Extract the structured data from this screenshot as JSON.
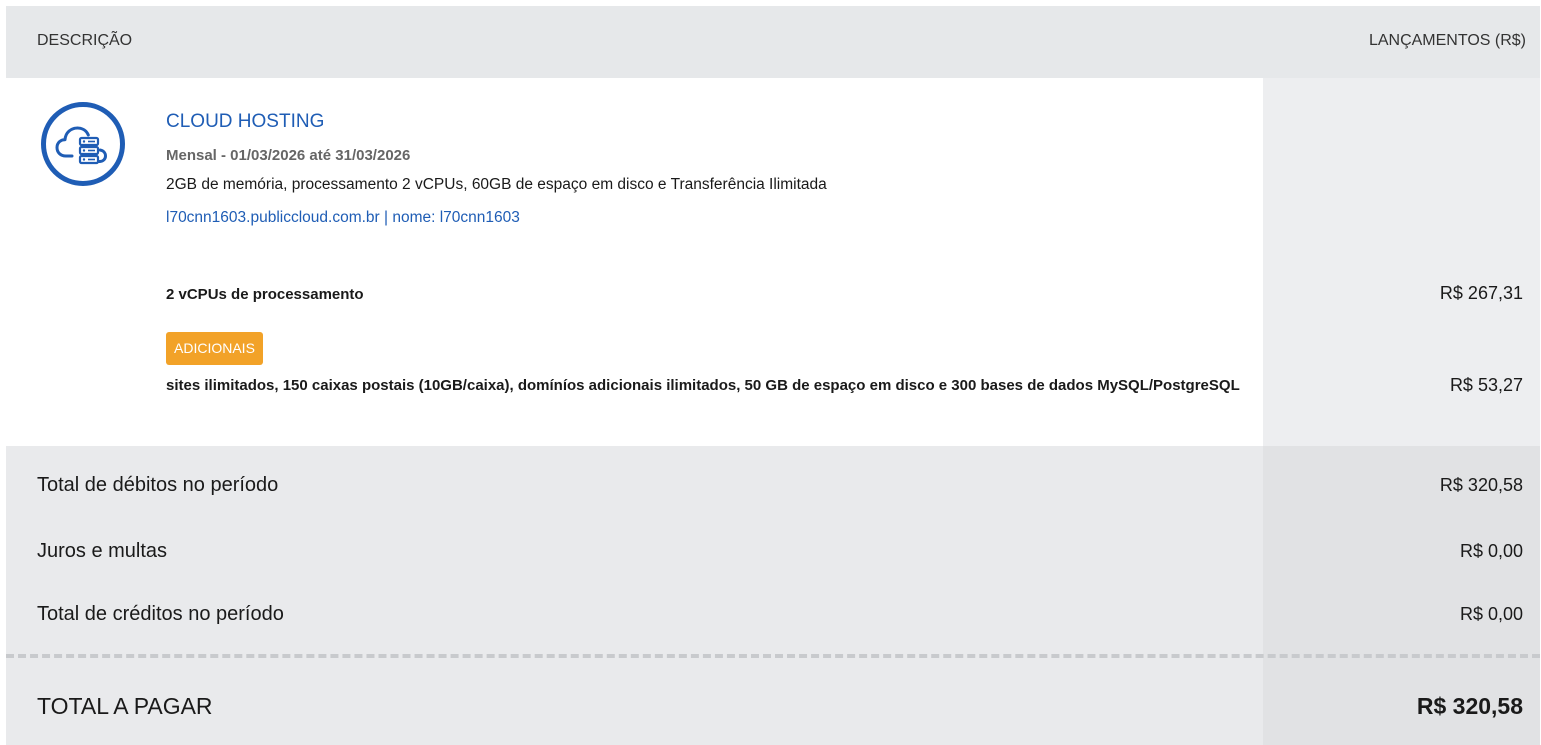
{
  "header": {
    "description_label": "DESCRIÇÃO",
    "launches_label": "LANÇAMENTOS (R$)"
  },
  "item": {
    "icon": "cloud-server-icon",
    "name": "CLOUD HOSTING",
    "period": "Mensal - 01/03/2026 até 31/03/2026",
    "specs": "2GB de memória, processamento 2 vCPUs, 60GB de espaço em disco e Transferência Ilimitada",
    "host": "l70cnn1603.publiccloud.com.br | nome: l70cnn1603",
    "lines": [
      {
        "label": "2 vCPUs de processamento",
        "value": "R$ 267,31"
      },
      {
        "badge": "ADICIONAIS",
        "label": "sites ilimitados, 150 caixas postais (10GB/caixa), domíníos adicionais ilimitados, 50 GB de espaço em disco e 300 bases de dados MySQL/PostgreSQL",
        "value": "R$ 53,27"
      }
    ]
  },
  "summary": {
    "rows": [
      {
        "label": "Total de débitos no período",
        "value": "R$ 320,58"
      },
      {
        "label": "Juros e multas",
        "value": "R$ 0,00"
      },
      {
        "label": "Total de créditos no período",
        "value": "R$ 0,00"
      }
    ],
    "total_label": "TOTAL A PAGAR",
    "total_value": "R$ 320,58"
  },
  "colors": {
    "link_blue": "#1f5db5",
    "badge_orange": "#f2a228",
    "header_bg": "#e6e8ea",
    "summary_bg": "#e9eaec"
  }
}
